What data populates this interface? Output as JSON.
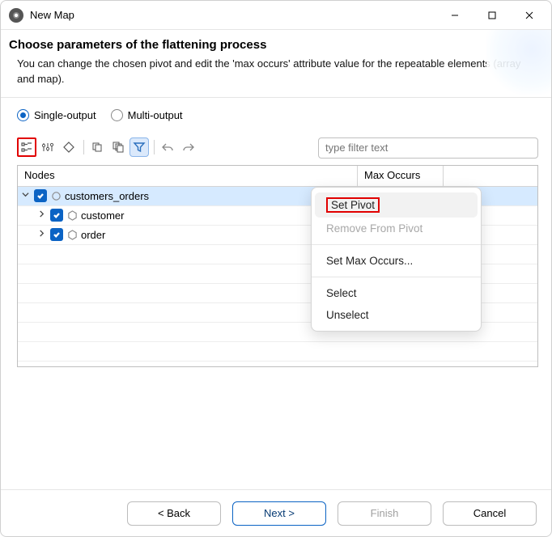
{
  "window": {
    "title": "New Map"
  },
  "header": {
    "title": "Choose parameters of the flattening process",
    "desc": "You can change the chosen pivot and edit the 'max occurs' attribute value for the repeatable elements (array and map)."
  },
  "radios": {
    "single": "Single-output",
    "multi": "Multi-output",
    "selected": "single"
  },
  "filter": {
    "placeholder": "type filter text",
    "value": ""
  },
  "columns": {
    "nodes": "Nodes",
    "max": "Max Occurs"
  },
  "tree": [
    {
      "label": "customers_orders",
      "expanded": true,
      "checked": true,
      "depth": 0,
      "selected": true,
      "icon": "circle"
    },
    {
      "label": "customer",
      "expanded": false,
      "checked": true,
      "depth": 1,
      "selected": false,
      "icon": "hex"
    },
    {
      "label": "order",
      "expanded": false,
      "checked": true,
      "depth": 1,
      "selected": false,
      "icon": "hex"
    }
  ],
  "context_menu": {
    "items": [
      {
        "label": "Set Pivot",
        "state": "highlighted"
      },
      {
        "label": "Remove From Pivot",
        "state": "disabled"
      },
      {
        "sep": true
      },
      {
        "label": "Set Max Occurs...",
        "state": "normal"
      },
      {
        "sep": true
      },
      {
        "label": "Select",
        "state": "normal"
      },
      {
        "label": "Unselect",
        "state": "normal"
      }
    ]
  },
  "footer": {
    "back": "< Back",
    "next": "Next >",
    "finish": "Finish",
    "cancel": "Cancel"
  }
}
